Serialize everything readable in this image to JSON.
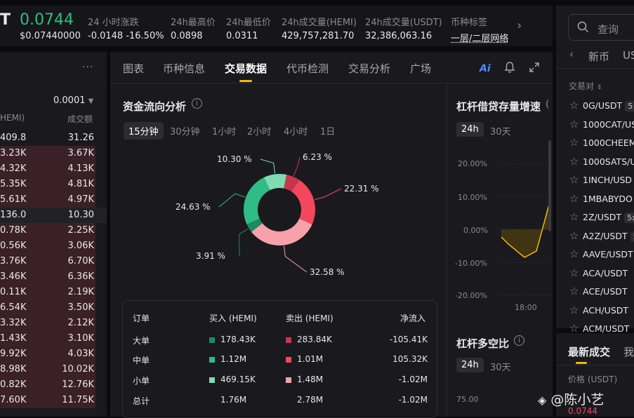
{
  "header": {
    "symbol_tail": "T",
    "price": "0.0744",
    "price_usd": "$0.07440000",
    "stats": [
      {
        "label": "24 小时涨跌",
        "value": "-0.0148 -16.50%"
      },
      {
        "label": "24h最高价",
        "value": "0.0898"
      },
      {
        "label": "24h最低价",
        "value": "0.0311"
      },
      {
        "label": "24h成交量(HEMI)",
        "value": "429,757,281.70"
      },
      {
        "label": "24h成交量(USDT)",
        "value": "32,386,063.16"
      },
      {
        "label": "币种标签",
        "value": "一层/二层网络"
      }
    ]
  },
  "orderbook": {
    "menu": "···",
    "precision": "0.0001",
    "col_left": "HEMI)",
    "col_right": "成交额",
    "rows": [
      {
        "p": "409.8",
        "a": "31.26",
        "side": "sell",
        "fill": 0
      },
      {
        "p": "3.23K",
        "a": "3.67K",
        "side": "sell",
        "fill": 1
      },
      {
        "p": "4.32K",
        "a": "4.13K",
        "side": "sell",
        "fill": 1
      },
      {
        "p": "5.35K",
        "a": "4.81K",
        "side": "sell",
        "fill": 1
      },
      {
        "p": "5.61K",
        "a": "4.97K",
        "side": "sell",
        "fill": 1
      },
      {
        "p": "136.0",
        "a": "10.30",
        "side": "mid",
        "fill": 0
      },
      {
        "p": "0.78K",
        "a": "2.25K",
        "side": "buy",
        "fill": 1
      },
      {
        "p": "0.56K",
        "a": "3.06K",
        "side": "buy",
        "fill": 1
      },
      {
        "p": "3.76K",
        "a": "6.70K",
        "side": "buy",
        "fill": 1
      },
      {
        "p": "3.46K",
        "a": "6.36K",
        "side": "buy",
        "fill": 1
      },
      {
        "p": "0.11K",
        "a": "2.19K",
        "side": "buy",
        "fill": 1
      },
      {
        "p": "6.54K",
        "a": "3.50K",
        "side": "buy",
        "fill": 1
      },
      {
        "p": "3.32K",
        "a": "2.12K",
        "side": "buy",
        "fill": 1
      },
      {
        "p": "1.43K",
        "a": "3.10K",
        "side": "buy",
        "fill": 1
      },
      {
        "p": "9.92K",
        "a": "4.03K",
        "side": "buy",
        "fill": 1
      },
      {
        "p": "8.98K",
        "a": "10.02K",
        "side": "buy",
        "fill": 1
      },
      {
        "p": "0.82K",
        "a": "12.76K",
        "side": "buy",
        "fill": 1
      },
      {
        "p": "7.60K",
        "a": "11.75K",
        "side": "buy",
        "fill": 1
      }
    ]
  },
  "tabs": [
    "图表",
    "币种信息",
    "交易数据",
    "代币检测",
    "交易分析",
    "广场"
  ],
  "tabs_active": "交易数据",
  "top_icons": {
    "ai": "Ai"
  },
  "fund_flow": {
    "title": "资金流向分析",
    "periods": [
      "15分钟",
      "30分钟",
      "1小时",
      "2小时",
      "4小时",
      "1日"
    ],
    "active_period": "15分钟",
    "slices": [
      {
        "label": "6.23 %",
        "value": 6.23,
        "color": "#c9364b"
      },
      {
        "label": "22.31 %",
        "value": 22.31,
        "color": "#f6465d"
      },
      {
        "label": "32.58 %",
        "value": 32.58,
        "color": "#f7a1aa"
      },
      {
        "label": "3.91 %",
        "value": 3.91,
        "color": "#1d8a5e"
      },
      {
        "label": "24.63 %",
        "value": 24.63,
        "color": "#2ebd85"
      },
      {
        "label": "10.30 %",
        "value": 10.3,
        "color": "#7fdbb1"
      }
    ],
    "table": {
      "headers": [
        "订单",
        "买入 (HEMI)",
        "卖出 (HEMI)",
        "净流入"
      ],
      "rows": [
        {
          "name": "大单",
          "buy": "178.43K",
          "sell": "283.84K",
          "net": "-105.41K",
          "buy_color": "#1d8a5e",
          "sell_color": "#c9364b"
        },
        {
          "name": "中单",
          "buy": "1.12M",
          "sell": "1.01M",
          "net": "105.32K",
          "buy_color": "#2ebd85",
          "sell_color": "#f6465d"
        },
        {
          "name": "小单",
          "buy": "469.15K",
          "sell": "1.48M",
          "net": "-1.02M",
          "buy_color": "#7fdbb1",
          "sell_color": "#f7a1aa"
        },
        {
          "name": "总计",
          "buy": "1.76M",
          "sell": "2.78M",
          "net": "-1.02M"
        }
      ]
    }
  },
  "leverage": {
    "title": "杠杆借贷存量增速",
    "periods": [
      "24h",
      "30天"
    ],
    "active_period": "24h",
    "yticks": [
      "20.00%",
      "10.00%",
      "0.00%",
      "-10.00%",
      "-20.00%"
    ],
    "xtick": "18:00"
  },
  "long_short": {
    "title": "杠杆多空比",
    "periods": [
      "24h",
      "30天"
    ],
    "active_period": "24h",
    "ytick": "75.00"
  },
  "market": {
    "search_placeholder": "查询",
    "tab": "新币",
    "tab2": "US",
    "col": "交易对",
    "pairs": [
      {
        "name": "0G/USDT",
        "badge": "5"
      },
      {
        "name": "1000CAT/US",
        "badge": ""
      },
      {
        "name": "1000CHEEM",
        "badge": ""
      },
      {
        "name": "1000SATS/U",
        "badge": ""
      },
      {
        "name": "1INCH/USD",
        "badge": ""
      },
      {
        "name": "1MBABYDO",
        "badge": ""
      },
      {
        "name": "2Z/USDT",
        "badge": "5x"
      },
      {
        "name": "A2Z/USDT",
        "badge": "5"
      },
      {
        "name": "AAVE/USDT",
        "badge": ""
      },
      {
        "name": "ACA/USDT",
        "badge": ""
      },
      {
        "name": "ACE/USDT",
        "badge": ""
      },
      {
        "name": "ACH/USDT",
        "badge": ""
      },
      {
        "name": "ACM/USDT",
        "badge": ""
      }
    ]
  },
  "trades": {
    "tab_active": "最新成交",
    "tab2": "我",
    "price_label": "价格 (USDT)",
    "price_value": "0.0744"
  },
  "watermark": "@陈小艺"
}
